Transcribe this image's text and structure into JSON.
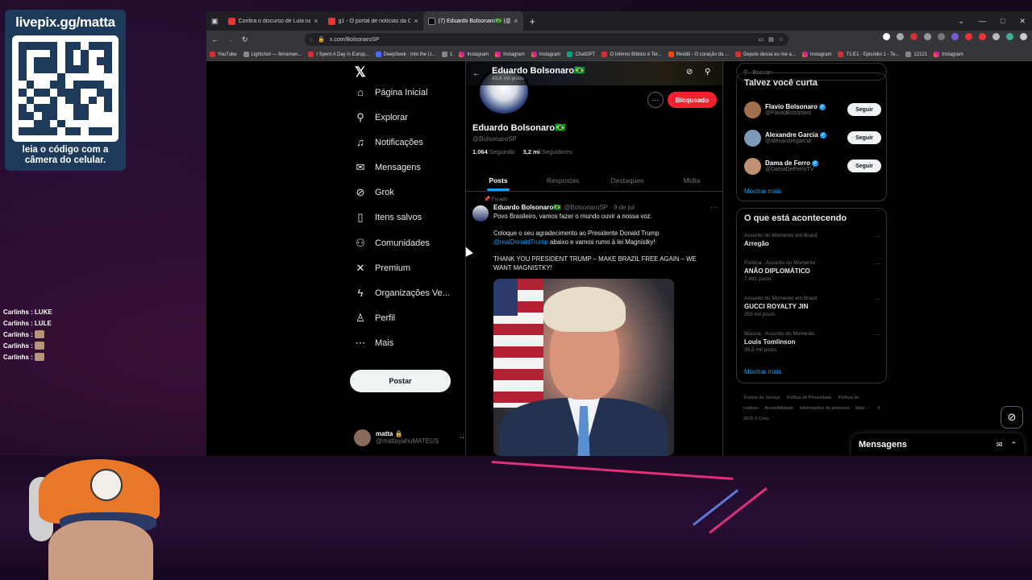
{
  "stream": {
    "qr_title": "livepix.gg/matta",
    "qr_caption": "leia o código com a câmera do celular.",
    "chat": [
      {
        "user": "Carlinhs :",
        "text": "LUKE"
      },
      {
        "user": "Carlinhs :",
        "text": "LULE"
      },
      {
        "user": "Carlinhs :",
        "text": ""
      },
      {
        "user": "Carlinhs :",
        "text": ""
      },
      {
        "user": "Carlinhs :",
        "text": ""
      }
    ]
  },
  "browser": {
    "tabs": [
      {
        "title": "Confira o discurso de Lula na C...",
        "icon": "youtube-icon"
      },
      {
        "title": "g1 - O portal de notícias da Gl...",
        "icon": "g1-icon"
      },
      {
        "title": "(7) Eduardo Bolsonaro🇧🇷 (@Bol...",
        "icon": "x-icon",
        "active": true
      }
    ],
    "url": "x.com/BolsonaroSP",
    "bookmarks": [
      {
        "label": "YouTube",
        "icon": "yt"
      },
      {
        "label": "Lightshot — ferramen...",
        "icon": "f"
      },
      {
        "label": "I Spent A Day in Europ...",
        "icon": "yt"
      },
      {
        "label": "DeepSeek - Into the U...",
        "icon": "d"
      },
      {
        "label": "1",
        "icon": "f"
      },
      {
        "label": "Instagram",
        "icon": "ig"
      },
      {
        "label": "Instagram",
        "icon": "ig"
      },
      {
        "label": "Instagram",
        "icon": "ig"
      },
      {
        "label": "ChatGPT",
        "icon": "g"
      },
      {
        "label": "O Inferno Bíblico é Ter...",
        "icon": "yt"
      },
      {
        "label": "Reddit - O coração da ...",
        "icon": "r"
      },
      {
        "label": "Depois dessa eu me a...",
        "icon": "yt"
      },
      {
        "label": "Instagram",
        "icon": "ig"
      },
      {
        "label": "T1:E1 - Episódio 1 - Te...",
        "icon": "yt"
      },
      {
        "label": "12121",
        "icon": "f"
      },
      {
        "label": "Instagram",
        "icon": "ig"
      }
    ]
  },
  "nav": {
    "items": [
      {
        "label": "Página Inicial",
        "icon": "home-icon",
        "glyph": "⌂"
      },
      {
        "label": "Explorar",
        "icon": "search-icon",
        "glyph": "⚲"
      },
      {
        "label": "Notificações",
        "icon": "bell-icon",
        "glyph": "♫"
      },
      {
        "label": "Mensagens",
        "icon": "mail-icon",
        "glyph": "✉"
      },
      {
        "label": "Grok",
        "icon": "grok-icon",
        "glyph": "⊘"
      },
      {
        "label": "Itens salvos",
        "icon": "bookmark-icon",
        "glyph": "▯"
      },
      {
        "label": "Comunidades",
        "icon": "communities-icon",
        "glyph": "⚇"
      },
      {
        "label": "Premium",
        "icon": "x-premium-icon",
        "glyph": "✕"
      },
      {
        "label": "Organizações Ve...",
        "icon": "lightning-icon",
        "glyph": "ϟ"
      },
      {
        "label": "Perfil",
        "icon": "person-icon",
        "glyph": "♙"
      },
      {
        "label": "Mais",
        "icon": "more-circle-icon",
        "glyph": "⋯"
      }
    ],
    "post_label": "Postar",
    "account_name": "matta 🔒",
    "account_handle": "@mattayahuMATEUS"
  },
  "profile": {
    "header_name": "Eduardo Bolsonaro🇧🇷",
    "header_posts": "43,6 mil posts",
    "name": "Eduardo Bolsonaro🇧🇷",
    "handle": "@BolsonaroSP",
    "following_count": "1.064",
    "following_label": "Seguindo",
    "followers_count": "3,2 mi",
    "followers_label": "Seguidores",
    "blocked_label": "Bloqueado",
    "tabs": [
      "Posts",
      "Respostas",
      "Destaques",
      "Mídia"
    ]
  },
  "tweet": {
    "pinned": "Fixado",
    "name": "Eduardo Bolsonaro🇧🇷",
    "meta": "@BolsonaroSP · 9 de jul",
    "line1": "Povo Brasileiro, vamos fazer o mundo ouvir a nossa voz.",
    "line2a": "Coloque o seu agradecimento ao Presidente Donald Trump",
    "mention": "@realDonaldTrump",
    "line2b": " abaixo e vamos rumo à lei Magnistky!",
    "line3": "THANK YOU PRESIDENT TRUMP – MAKE BRAZIL FREE AGAIN – WE WANT MAGNISTKY!"
  },
  "sidebar": {
    "search_placeholder": "Buscar",
    "who_title": "Talvez você curta",
    "who": [
      {
        "name": "Flavio Bolsonaro",
        "handle": "@FlavioBolsonaro",
        "color": "#a0704e"
      },
      {
        "name": "Alexandre Garcia",
        "handle": "@alexandregarcia",
        "color": "#7d9ab8"
      },
      {
        "name": "Dama de Ferro",
        "handle": "@DamaDeFerroTV",
        "color": "#c29070"
      }
    ],
    "follow_label": "Seguir",
    "show_more": "Mostrar mais",
    "trends_title": "O que está acontecendo",
    "trends": [
      {
        "context": "Assunto do Momento em Brasil",
        "title": "Arregão",
        "count": ""
      },
      {
        "context": "Política · Assunto do Momento",
        "title": "ANÃO DIPLOMÁTICO",
        "count": "7.481 posts"
      },
      {
        "context": "Assunto do Momento em Brasil",
        "title": "GUCCI ROYALTY JIN",
        "count": "255 mil posts"
      },
      {
        "context": "Música · Assunto do Momento",
        "title": "Louis Tomlinson",
        "count": "30,5 mil posts"
      }
    ],
    "footer": [
      "Termos de Serviço",
      "Política de Privacidade",
      "Política de cookies",
      "Acessibilidade",
      "Informações de anúncios",
      "Mais ···",
      "© 2025 X Corp."
    ]
  },
  "messages_drawer": {
    "title": "Mensagens"
  }
}
